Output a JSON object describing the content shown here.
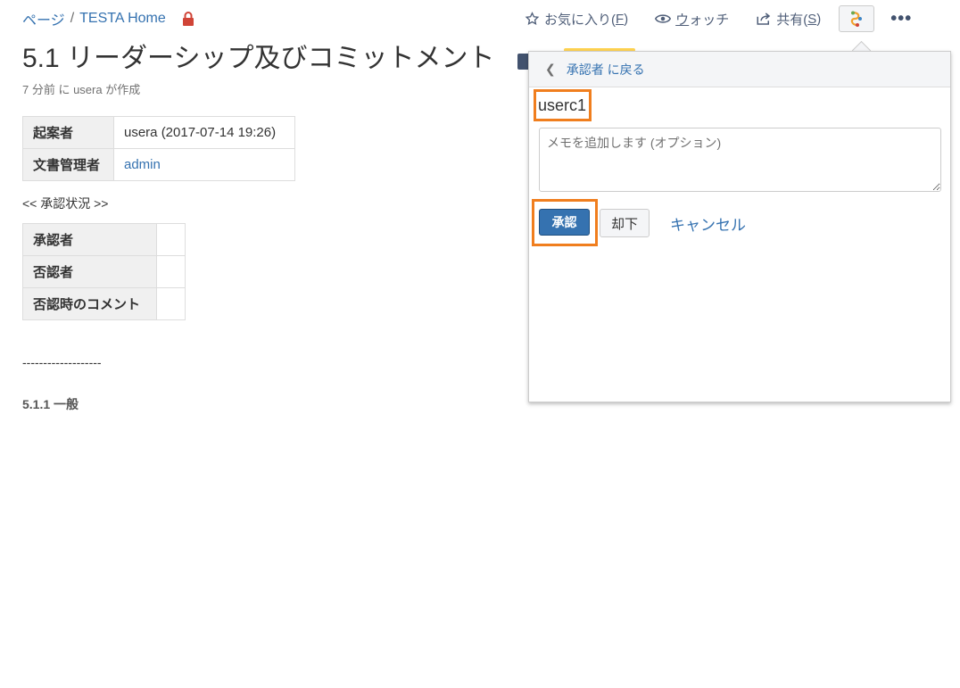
{
  "breadcrumb": {
    "pages": "ページ",
    "separator": "/",
    "space": "TESTA Home"
  },
  "toolbar": {
    "favorite": "お気に入り(",
    "favorite_key": "F",
    "favorite_end": ")",
    "watch_key": "ウ",
    "watch": "ォッチ",
    "share": "共有(",
    "share_key": "S",
    "share_end": ")",
    "more": "•••"
  },
  "page": {
    "title": "5.1 リーダーシップ及びコミットメント",
    "meta": "7 分前 に usera が作成"
  },
  "info_table": [
    {
      "label": "起案者",
      "value": "usera (2017-07-14 19:26)",
      "is_link": false
    },
    {
      "label": "文書管理者",
      "value": "admin",
      "is_link": true
    }
  ],
  "approval_status_label": "<< 承認状況 >>",
  "approval_table": [
    {
      "label": "承認者",
      "value": ""
    },
    {
      "label": "否認者",
      "value": ""
    },
    {
      "label": "否認時のコメント",
      "value": ""
    }
  ],
  "divider_text": "-------------------",
  "section_heading": "5.1.1 一般",
  "panel": {
    "back_link": "承認者 に戻る",
    "user": "userc1",
    "memo_placeholder": "メモを追加します (オプション)",
    "approve_label": "承認",
    "reject_label": "却下",
    "cancel_label": "キャンセル"
  },
  "colors": {
    "accent": "#3572b0",
    "highlight": "#f07e1e",
    "lock": "#d04437"
  }
}
